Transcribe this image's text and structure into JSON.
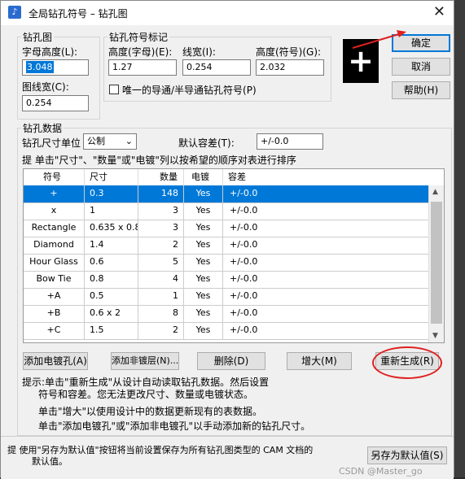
{
  "window": {
    "title": "全局钻孔符号 – 钻孔图",
    "close_glyph": "✕",
    "app_icon": "app-icon"
  },
  "drill_chart": {
    "group": "钻孔图",
    "char_height_label": "字母高度(L):",
    "char_height": "3.048",
    "line_width_label": "图线宽(C):",
    "line_width": "0.254"
  },
  "symbol_marker": {
    "group": "钻孔符号标记",
    "height_label": "高度(字母)(E):",
    "height": "1.27",
    "line_width_label": "线宽(I):",
    "line_width": "0.254",
    "symbol_height_label": "高度(符号)(G):",
    "symbol_height": "2.032",
    "unique_checkbox_label": "唯一的导通/半导通钻孔符号(P)"
  },
  "preview": {
    "symbol": "+"
  },
  "buttons": {
    "ok": "确定",
    "cancel": "取消",
    "help": "帮助(H)",
    "add_plated": "添加电镀孔(A)",
    "add_nonplated": "添加非镀层(N)...",
    "delete": "删除(D)",
    "enlarge": "增大(M)",
    "regenerate": "重新生成(R)",
    "save_default": "另存为默认值(S)"
  },
  "drill_data": {
    "group": "钻孔数据",
    "unit_label": "钻孔尺寸单位",
    "unit": "公制",
    "tolerance_label": "默认容差(T):",
    "tolerance": "+/-0.0",
    "sort_hint": "提   单击\"尺寸\"、\"数量\"或\"电镀\"列以按希望的顺序对表进行排序"
  },
  "table": {
    "headers": [
      "符号",
      "尺寸",
      "数量",
      "电镀",
      "容差"
    ],
    "rows": [
      [
        "+",
        "0.3",
        "148",
        "Yes",
        "+/-0.0"
      ],
      [
        "x",
        "1",
        "3",
        "Yes",
        "+/-0.0"
      ],
      [
        "Rectangle",
        "0.635 x 0.8",
        "3",
        "Yes",
        "+/-0.0"
      ],
      [
        "Diamond",
        "1.4",
        "2",
        "Yes",
        "+/-0.0"
      ],
      [
        "Hour Glass",
        "0.6",
        "5",
        "Yes",
        "+/-0.0"
      ],
      [
        "Bow Tie",
        "0.8",
        "4",
        "Yes",
        "+/-0.0"
      ],
      [
        "+A",
        "0.5",
        "1",
        "Yes",
        "+/-0.0"
      ],
      [
        "+B",
        "0.6 x 2",
        "8",
        "Yes",
        "+/-0.0"
      ],
      [
        "+C",
        "1.5",
        "2",
        "Yes",
        "+/-0.0"
      ]
    ]
  },
  "notes": {
    "line1": "提示:单击\"重新生成\"从设计自动读取钻孔数据。然后设置",
    "line2": "符号和容差。您无法更改尺寸、数量或电镀状态。",
    "line3": "单击\"增大\"以使用设计中的数据更新现有的表数据。",
    "line4": "单击\"添加电镀孔\"或\"添加非电镀孔\"以手动添加新的钻孔尺寸。"
  },
  "footer": {
    "hint1": "提   使用\"另存为默认值\"按钮将当前设置保存为所有钻孔图类型的 CAM 文档的",
    "hint2": "默认值。",
    "watermark": "CSDN @Master_go"
  },
  "colors": {
    "selection": "#0078d7",
    "annotation": "#e02020"
  }
}
